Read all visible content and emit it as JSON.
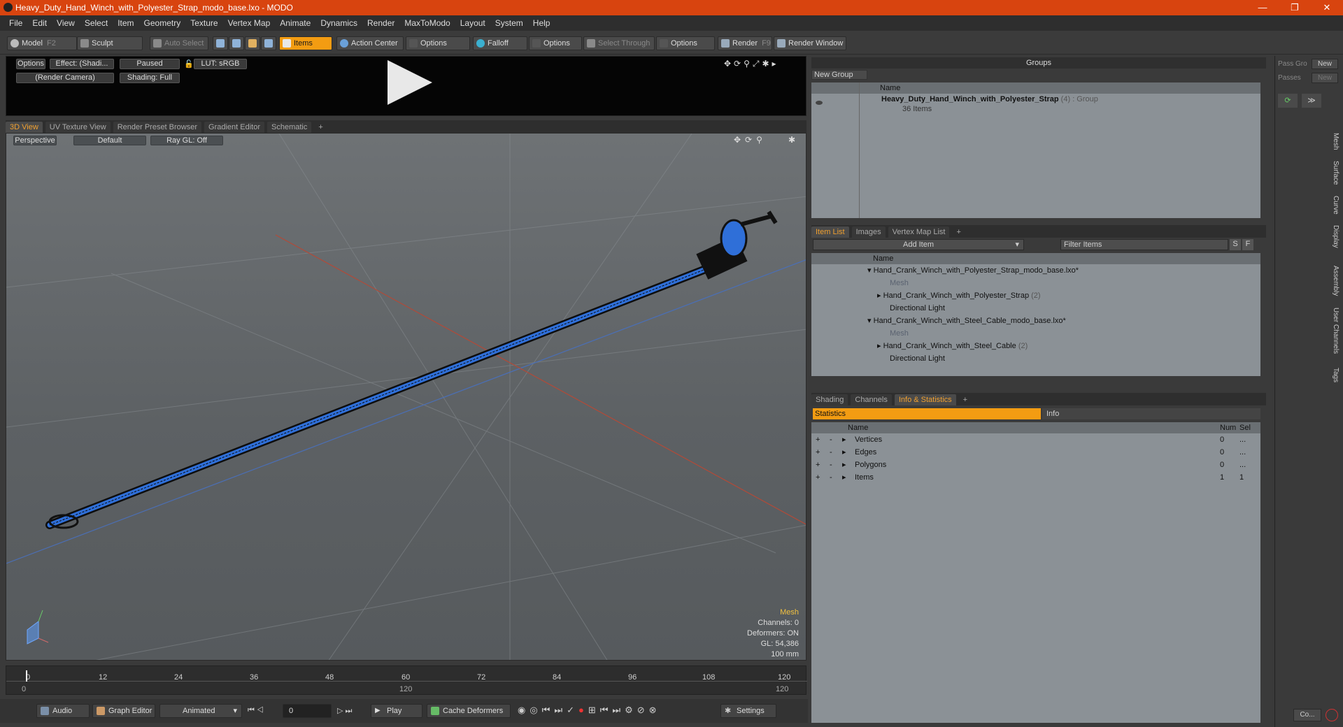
{
  "window": {
    "title": "Heavy_Duty_Hand_Winch_with_Polyester_Strap_modo_base.lxo - MODO",
    "min": "—",
    "max": "❐",
    "close": "✕"
  },
  "menu": [
    "File",
    "Edit",
    "View",
    "Select",
    "Item",
    "Geometry",
    "Texture",
    "Vertex Map",
    "Animate",
    "Dynamics",
    "Render",
    "MaxToModo",
    "Layout",
    "System",
    "Help"
  ],
  "toolbar": {
    "model": "Model",
    "model_key": "F2",
    "sculpt": "Sculpt",
    "auto_select": "Auto Select",
    "items": "Items",
    "action_center": "Action Center",
    "options1": "Options",
    "falloff": "Falloff",
    "options2": "Options",
    "select_through": "Select Through",
    "options3": "Options",
    "render": "Render",
    "render_key": "F9",
    "render_window": "Render Window"
  },
  "preview": {
    "options": "Options",
    "effect": "Effect: (Shadi...",
    "paused": "Paused",
    "lut": "LUT: sRGB",
    "camera": "(Render Camera)",
    "shading": "Shading: Full"
  },
  "view_tabs": [
    "3D View",
    "UV Texture View",
    "Render Preset Browser",
    "Gradient Editor",
    "Schematic",
    "+"
  ],
  "viewport": {
    "perspective": "Perspective",
    "default": "Default",
    "raygl": "Ray GL: Off",
    "hud": {
      "mesh": "Mesh",
      "channels": "Channels: 0",
      "deformers": "Deformers: ON",
      "gl": "GL: 54,386",
      "scale": "100 mm"
    }
  },
  "timeline": {
    "ticks": [
      "0",
      "12",
      "24",
      "36",
      "48",
      "60",
      "72",
      "84",
      "96",
      "108",
      "120"
    ],
    "bottom_left": "0",
    "bottom_mid": "120",
    "bottom_right": "120"
  },
  "bottombar": {
    "audio": "Audio",
    "graph_editor": "Graph Editor",
    "animated": "Animated",
    "frame": "0",
    "play": "Play",
    "cache_deformers": "Cache Deformers",
    "settings": "Settings"
  },
  "groups": {
    "header": "Groups",
    "new_group": "New Group",
    "col_name": "Name",
    "item_name": "Heavy_Duty_Hand_Winch_with_Polyester_Strap",
    "item_count": "(4)",
    "item_type": ": Group",
    "item_sub": "36 Items"
  },
  "passes": {
    "pass_gro": "Pass Gro",
    "new1": "New",
    "passes": "Passes",
    "new2": "New"
  },
  "item_list": {
    "tabs": [
      "Item List",
      "Images",
      "Vertex Map List",
      "+"
    ],
    "add_item": "Add Item",
    "filter": "Filter Items",
    "s": "S",
    "f": "F",
    "col_name": "Name",
    "rows": [
      {
        "label": "Hand_Crank_Winch_with_Polyester_Strap_modo_base.lxo*",
        "count": ""
      },
      {
        "label": "Mesh",
        "count": ""
      },
      {
        "label": "Hand_Crank_Winch_with_Polyester_Strap",
        "count": "(2)"
      },
      {
        "label": "Directional Light",
        "count": ""
      },
      {
        "label": "Hand_Crank_Winch_with_Steel_Cable_modo_base.lxo*",
        "count": ""
      },
      {
        "label": "Mesh",
        "count": ""
      },
      {
        "label": "Hand_Crank_Winch_with_Steel_Cable",
        "count": "(2)"
      },
      {
        "label": "Directional Light",
        "count": ""
      }
    ]
  },
  "stats": {
    "tabs": [
      "Shading",
      "Channels",
      "Info & Statistics",
      "+"
    ],
    "statistics": "Statistics",
    "info": "Info",
    "cols": {
      "name": "Name",
      "num": "Num",
      "sel": "Sel"
    },
    "rows": [
      {
        "name": "Vertices",
        "num": "0",
        "sel": "..."
      },
      {
        "name": "Edges",
        "num": "0",
        "sel": "..."
      },
      {
        "name": "Polygons",
        "num": "0",
        "sel": "..."
      },
      {
        "name": "Items",
        "num": "1",
        "sel": "1"
      }
    ]
  },
  "side_tabs": [
    "Mesh",
    "Surface",
    "Curve",
    "Display",
    "Assembly",
    "User Channels",
    "Tags"
  ],
  "corner": {
    "co": "Co..."
  },
  "colors": {
    "titlebar": "#d8440f",
    "accent": "#f39c12",
    "mesh_blue": "#2f6fd8"
  }
}
